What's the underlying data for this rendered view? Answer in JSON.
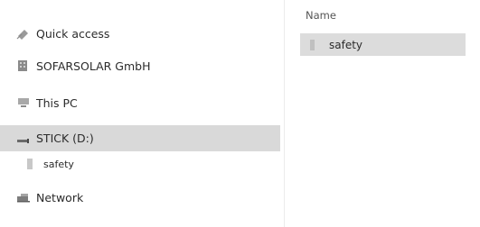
{
  "navigation": {
    "items": [
      {
        "label": "Quick access",
        "icon": "quick-access-pin-icon"
      },
      {
        "label": "SOFARSOLAR GmbH",
        "icon": "company-folder-icon"
      },
      {
        "label": "This PC",
        "icon": "computer-icon"
      },
      {
        "label": "STICK (D:)",
        "icon": "usb-drive-icon",
        "selected": true
      },
      {
        "label": "safety",
        "icon": "folder-icon"
      },
      {
        "label": "Network",
        "icon": "network-icon"
      }
    ]
  },
  "content": {
    "column_header": "Name",
    "files": [
      {
        "name": "safety",
        "icon": "folder-icon",
        "selected": true
      }
    ]
  },
  "colors": {
    "selection": "#d9d9d9",
    "background": "#ffffff",
    "text": "#2b2b2b"
  }
}
